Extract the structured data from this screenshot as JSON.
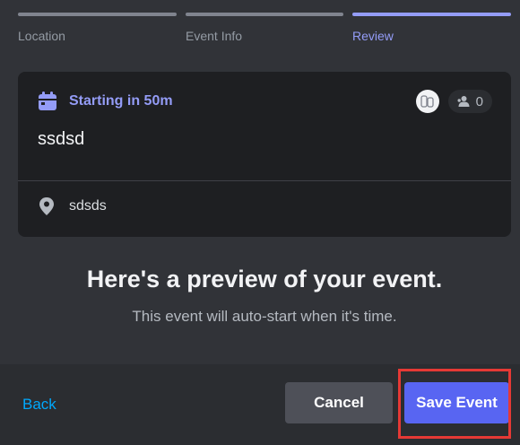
{
  "steps": [
    {
      "label": "Location",
      "state": "complete"
    },
    {
      "label": "Event Info",
      "state": "complete"
    },
    {
      "label": "Review",
      "state": "active"
    }
  ],
  "event": {
    "starting": "Starting in 50m",
    "title": "ssdsd",
    "location": "sdsds",
    "interested_count": "0"
  },
  "preview": {
    "heading": "Here's a preview of your event.",
    "subtext": "This event will auto-start when it's time."
  },
  "footer": {
    "back_label": "Back",
    "cancel_label": "Cancel",
    "save_label": "Save Event"
  },
  "colors": {
    "accent": "#949cf7",
    "primary_button": "#5865f2",
    "secondary_button": "#4e5058",
    "link": "#00a8fc",
    "highlight": "#e53935"
  },
  "icons": [
    "calendar-icon",
    "guild-avatar-icon",
    "people-icon",
    "location-pin-icon"
  ]
}
